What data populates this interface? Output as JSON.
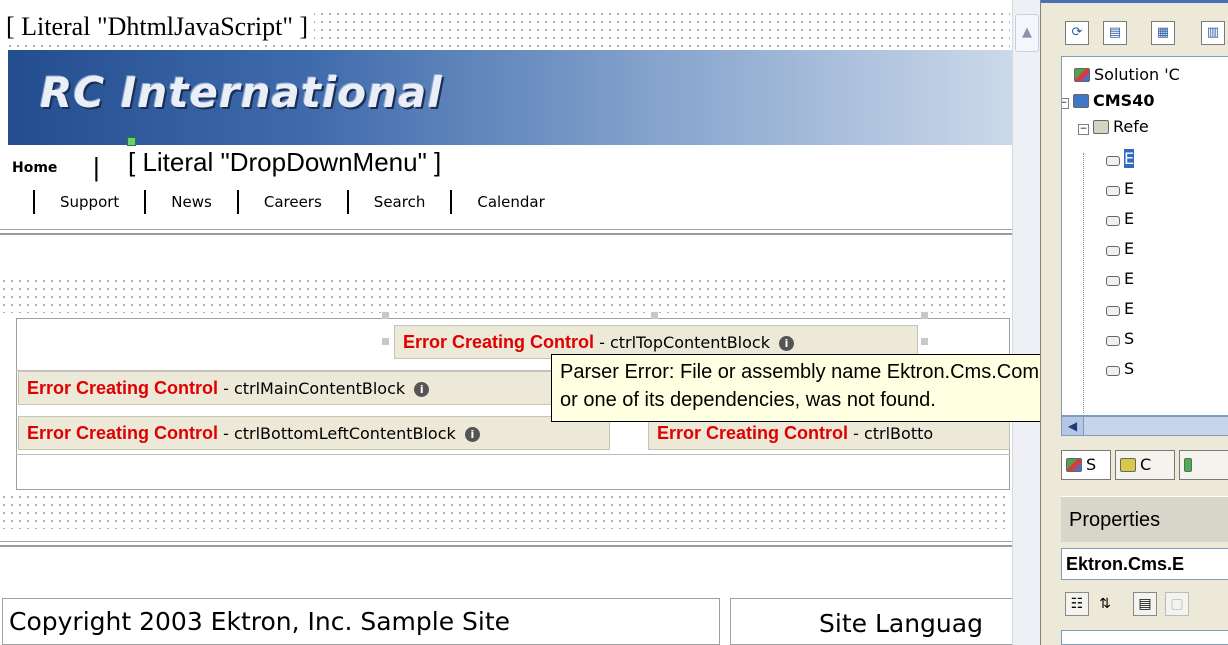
{
  "designer": {
    "literal_dhtml": "[ Literal \"DhtmlJavaScript\" ]",
    "banner_logo": "RC International",
    "nav": {
      "home": "Home",
      "separator": "|",
      "literal_dropdown": "[ Literal \"DropDownMenu\" ]",
      "links": [
        "Support",
        "News",
        "Careers",
        "Search",
        "Calendar"
      ]
    },
    "controls": {
      "error_label": "Error Creating Control",
      "top": " - ctrlTopContentBlock",
      "main": " - ctrlMainContentBlock",
      "bottom_left": " - ctrlBottomLeftContentBlock",
      "bottom_right": " - ctrlBotto",
      "info_icon": "i"
    },
    "tooltip": {
      "line1": "Parser Error: File or assembly name Ektron.Cms.Common,",
      "line2": "or one of its dependencies, was not found."
    },
    "footer": {
      "copyright": "Copyright 2003 Ektron, Inc. Sample Site",
      "language": "Site Languag"
    }
  },
  "solution_explorer": {
    "toolbar": [
      "refresh-icon",
      "show-all-files-icon",
      "properties-icon",
      "view-code-icon"
    ],
    "tree": {
      "solution": "Solution 'C",
      "project": "CMS40",
      "references": "Refe",
      "reference_items": [
        "E",
        "E",
        "E",
        "E",
        "E",
        "E",
        "S",
        "S"
      ]
    },
    "tabs": [
      "S",
      "C"
    ]
  },
  "properties": {
    "title": "Properties",
    "object": "Ektron.Cms.E"
  }
}
